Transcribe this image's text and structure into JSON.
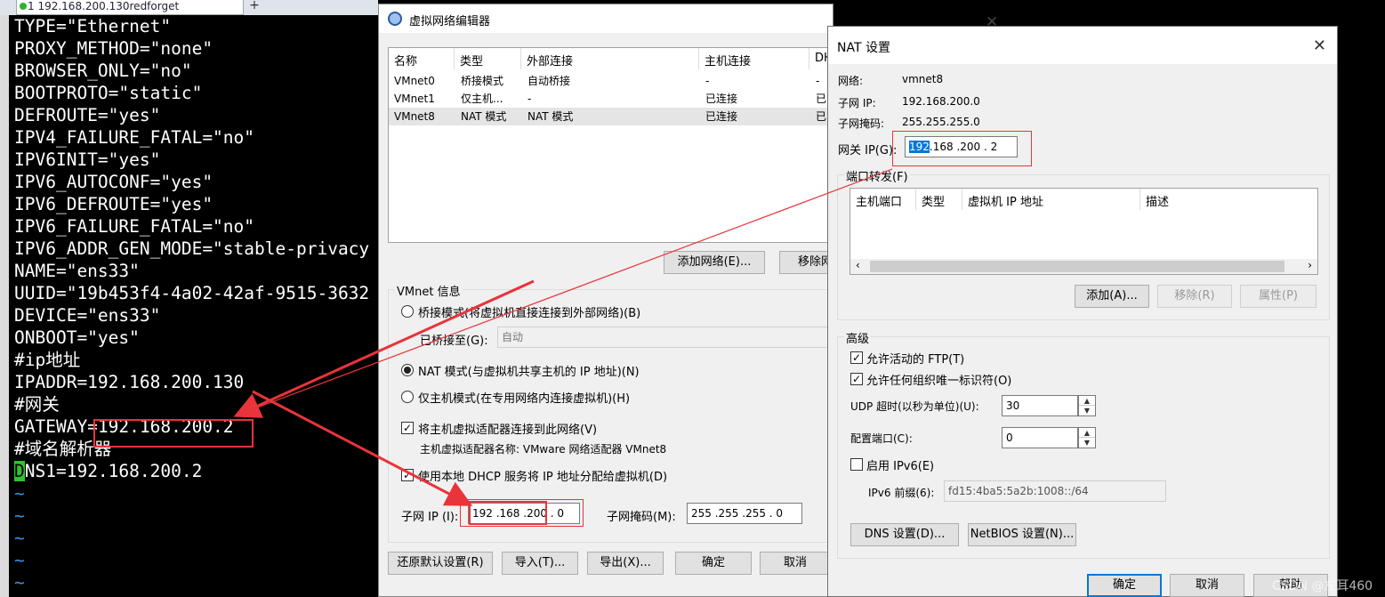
{
  "terminal": {
    "tab_title": "1 192.168.200.130redforget",
    "lines": [
      "TYPE=\"Ethernet\"",
      "PROXY_METHOD=\"none\"",
      "BROWSER_ONLY=\"no\"",
      "BOOTPROTO=\"static\"",
      "DEFROUTE=\"yes\"",
      "IPV4_FAILURE_FATAL=\"no\"",
      "IPV6INIT=\"yes\"",
      "IPV6_AUTOCONF=\"yes\"",
      "IPV6_DEFROUTE=\"yes\"",
      "IPV6_FAILURE_FATAL=\"no\"",
      "IPV6_ADDR_GEN_MODE=\"stable-privacy",
      "NAME=\"ens33\"",
      "UUID=\"19b453f4-4a02-42af-9515-3632",
      "DEVICE=\"ens33\"",
      "ONBOOT=\"yes\"",
      "#ip地址",
      "IPADDR=192.168.200.130",
      "#网关",
      "GATEWAY=192.168.200.2",
      "#域名解析器"
    ],
    "dns_cursor": "D",
    "dns_rest": "NS1=192.168.200.2",
    "tilde": "~"
  },
  "vne": {
    "title": "虚拟网络编辑器",
    "headers": [
      "名称",
      "类型",
      "外部连接",
      "主机连接",
      "DHCP"
    ],
    "rows": [
      [
        "VMnet0",
        "桥接模式",
        "自动桥接",
        "-",
        "-"
      ],
      [
        "VMnet1",
        "仅主机...",
        "-",
        "已连接",
        "已"
      ],
      [
        "VMnet8",
        "NAT 模式",
        "NAT 模式",
        "已连接",
        "已"
      ]
    ],
    "add_network": "添加网络(E)...",
    "remove_network": "移除网",
    "info_label": "VMnet 信息",
    "bridge_mode": "桥接模式(将虚拟机直接连接到外部网络)(B)",
    "bridged_to": "已桥接至(G):",
    "bridged_value": "自动",
    "nat_mode": "NAT 模式(与虚拟机共享主机的 IP 地址)(N)",
    "host_only": "仅主机模式(在专用网络内连接虚拟机)(H)",
    "connect_adapter": "将主机虚拟适配器连接到此网络(V)",
    "adapter_name": "主机虚拟适配器名称: VMware 网络适配器 VMnet8",
    "use_dhcp": "使用本地 DHCP 服务将 IP 地址分配给虚拟机(D)",
    "subnet_ip_label": "子网 IP (I):",
    "subnet_ip_value": "192 .168 .200 . 0",
    "subnet_mask_label": "子网掩码(M):",
    "subnet_mask_value": "255 .255 .255 . 0",
    "restore": "还原默认设置(R)",
    "import": "导入(T)...",
    "export": "导出(X)...",
    "ok": "确定",
    "cancel": "取消"
  },
  "nat": {
    "title": "NAT 设置",
    "network_label": "网络:",
    "network_value": "vmnet8",
    "subnet_label": "子网 IP:",
    "subnet_value": "192.168.200.0",
    "mask_label": "子网掩码:",
    "mask_value": "255.255.255.0",
    "gateway_label": "网关 IP(G):",
    "gateway_sel": "192",
    "gateway_rest": ".168 .200 . 2",
    "pf_label": "端口转发(F)",
    "pf_headers": [
      "主机端口",
      "类型",
      "虚拟机 IP 地址",
      "描述"
    ],
    "add": "添加(A)...",
    "remove": "移除(R)",
    "props": "属性(P)",
    "advanced": "高级",
    "allow_ftp": "允许活动的 FTP(T)",
    "allow_oui": "允许任何组织唯一标识符(O)",
    "udp_label": "UDP 超时(以秒为单位)(U):",
    "udp_value": "30",
    "cfg_port_label": "配置端口(C):",
    "cfg_port_value": "0",
    "ipv6_enable": "启用 IPv6(E)",
    "ipv6_prefix_label": "IPv6 前缀(6):",
    "ipv6_prefix_value": "fd15:4ba5:5a2b:1008::/64",
    "dns": "DNS 设置(D)...",
    "netbios": "NetBIOS 设置(N)...",
    "ok": "确定",
    "cancel": "取消",
    "help": "帮助"
  },
  "watermark": "CSDN @左耳460",
  "colors": {
    "accent": "#0078d7",
    "annotation": "#e8343a"
  }
}
